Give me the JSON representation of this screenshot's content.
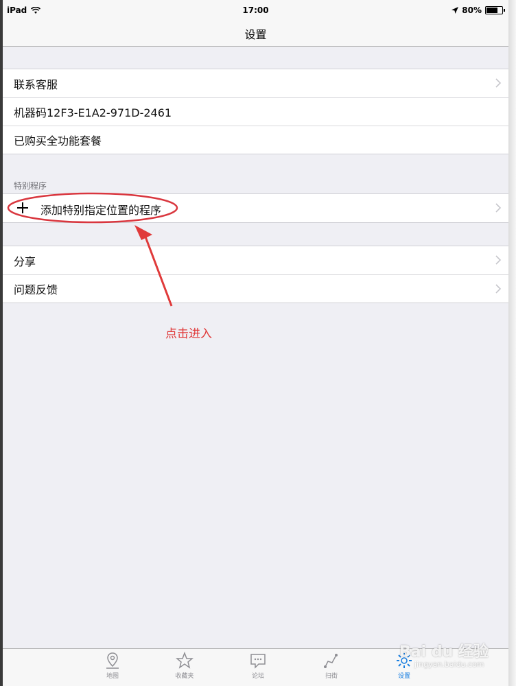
{
  "status_bar": {
    "device": "iPad",
    "time": "17:00",
    "battery": "80%",
    "battery_level": 0.8
  },
  "nav": {
    "title": "设置"
  },
  "group1": {
    "items": [
      {
        "label": "联系客服",
        "has_chevron": true
      },
      {
        "label": "机器码12F3-E1A2-971D-2461",
        "has_chevron": false
      },
      {
        "label": "已购买全功能套餐",
        "has_chevron": false
      }
    ]
  },
  "group2": {
    "header": "特别程序",
    "add_item": {
      "label": "添加特别指定位置的程序",
      "icon": "plus-icon"
    }
  },
  "group3": {
    "items": [
      {
        "label": "分享",
        "has_chevron": true
      },
      {
        "label": "问题反馈",
        "has_chevron": true
      }
    ]
  },
  "annotation": {
    "text": "点击进入",
    "color": "#e03a3a"
  },
  "tabbar": {
    "tabs": [
      {
        "label": "地图",
        "icon": "map-pin-icon"
      },
      {
        "label": "收藏夹",
        "icon": "star-icon"
      },
      {
        "label": "论坛",
        "icon": "chat-bubble-icon"
      },
      {
        "label": "扫街",
        "icon": "route-icon"
      },
      {
        "label": "设置",
        "icon": "gear-icon",
        "active": true
      }
    ],
    "active_color": "#1a7fe0"
  },
  "watermark": {
    "text": "Bai du 经验",
    "sub": "jingyan.baidu.com"
  }
}
